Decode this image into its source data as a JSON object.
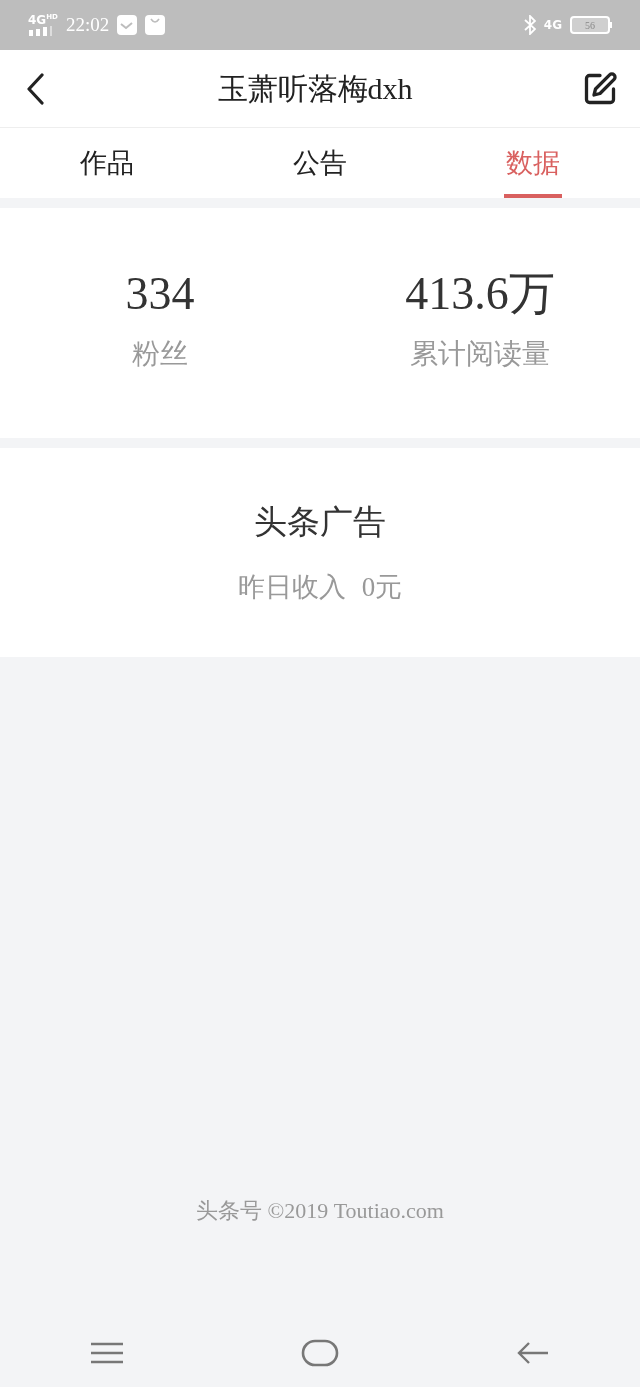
{
  "status_bar": {
    "network": "4G",
    "network_badge": "HD",
    "time": "22:02",
    "right_network": "4G",
    "battery": "56"
  },
  "header": {
    "title": "玉萧听落梅dxh"
  },
  "tabs": [
    {
      "label": "作品",
      "selected": false
    },
    {
      "label": "公告",
      "selected": false
    },
    {
      "label": "数据",
      "selected": true
    }
  ],
  "stats": [
    {
      "value": "334",
      "label": "粉丝"
    },
    {
      "value": "413.6万",
      "label": "累计阅读量"
    }
  ],
  "ad_card": {
    "title": "头条广告",
    "income_label": "昨日收入",
    "income_value": "0元"
  },
  "footer": {
    "text": "头条号 ©2019 Toutiao.com"
  }
}
